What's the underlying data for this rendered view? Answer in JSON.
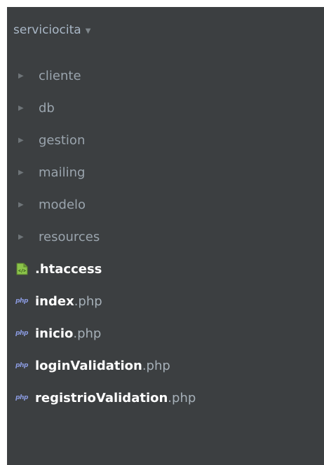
{
  "project": {
    "name": "serviciocita",
    "dropdown_icon": "caret-down-icon"
  },
  "tree": {
    "folders": [
      {
        "label": "cliente"
      },
      {
        "label": "db"
      },
      {
        "label": "gestion"
      },
      {
        "label": "mailing"
      },
      {
        "label": "modelo"
      },
      {
        "label": "resources"
      }
    ],
    "files": [
      {
        "name": ".htaccess",
        "ext": "",
        "icon": "htaccess-file-icon",
        "icon_text": "</>"
      },
      {
        "name": "index",
        "ext": ".php",
        "icon": "php-file-icon",
        "icon_text": "php"
      },
      {
        "name": "inicio",
        "ext": ".php",
        "icon": "php-file-icon",
        "icon_text": "php"
      },
      {
        "name": "loginValidation",
        "ext": ".php",
        "icon": "php-file-icon",
        "icon_text": "php"
      },
      {
        "name": "registrioValidation",
        "ext": ".php",
        "icon": "php-file-icon",
        "icon_text": "php"
      }
    ]
  },
  "colors": {
    "panel_background": "#3c3f41",
    "folder_text": "#9aa4ad",
    "file_text": "#ffffff",
    "php_icon": "#8a9adf",
    "htaccess_icon": "#8bc34a"
  }
}
